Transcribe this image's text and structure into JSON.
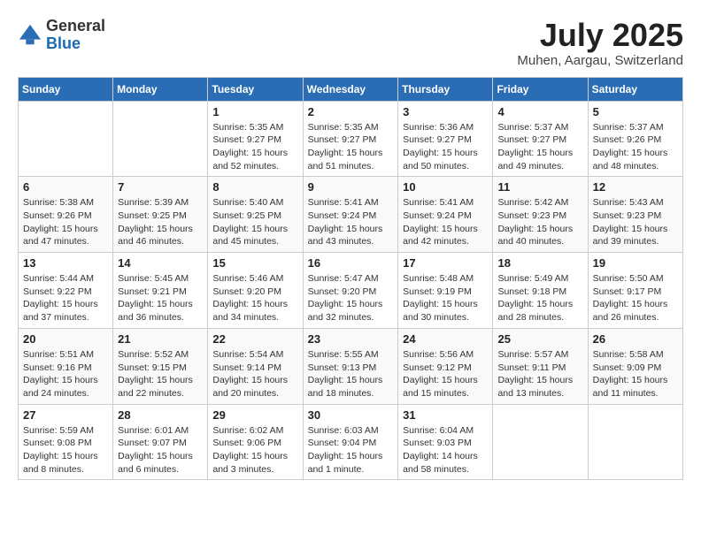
{
  "header": {
    "logo": {
      "general": "General",
      "blue": "Blue"
    },
    "title": "July 2025",
    "location": "Muhen, Aargau, Switzerland"
  },
  "weekdays": [
    "Sunday",
    "Monday",
    "Tuesday",
    "Wednesday",
    "Thursday",
    "Friday",
    "Saturday"
  ],
  "weeks": [
    [
      {
        "day": "",
        "info": ""
      },
      {
        "day": "",
        "info": ""
      },
      {
        "day": "1",
        "info": "Sunrise: 5:35 AM\nSunset: 9:27 PM\nDaylight: 15 hours\nand 52 minutes."
      },
      {
        "day": "2",
        "info": "Sunrise: 5:35 AM\nSunset: 9:27 PM\nDaylight: 15 hours\nand 51 minutes."
      },
      {
        "day": "3",
        "info": "Sunrise: 5:36 AM\nSunset: 9:27 PM\nDaylight: 15 hours\nand 50 minutes."
      },
      {
        "day": "4",
        "info": "Sunrise: 5:37 AM\nSunset: 9:27 PM\nDaylight: 15 hours\nand 49 minutes."
      },
      {
        "day": "5",
        "info": "Sunrise: 5:37 AM\nSunset: 9:26 PM\nDaylight: 15 hours\nand 48 minutes."
      }
    ],
    [
      {
        "day": "6",
        "info": "Sunrise: 5:38 AM\nSunset: 9:26 PM\nDaylight: 15 hours\nand 47 minutes."
      },
      {
        "day": "7",
        "info": "Sunrise: 5:39 AM\nSunset: 9:25 PM\nDaylight: 15 hours\nand 46 minutes."
      },
      {
        "day": "8",
        "info": "Sunrise: 5:40 AM\nSunset: 9:25 PM\nDaylight: 15 hours\nand 45 minutes."
      },
      {
        "day": "9",
        "info": "Sunrise: 5:41 AM\nSunset: 9:24 PM\nDaylight: 15 hours\nand 43 minutes."
      },
      {
        "day": "10",
        "info": "Sunrise: 5:41 AM\nSunset: 9:24 PM\nDaylight: 15 hours\nand 42 minutes."
      },
      {
        "day": "11",
        "info": "Sunrise: 5:42 AM\nSunset: 9:23 PM\nDaylight: 15 hours\nand 40 minutes."
      },
      {
        "day": "12",
        "info": "Sunrise: 5:43 AM\nSunset: 9:23 PM\nDaylight: 15 hours\nand 39 minutes."
      }
    ],
    [
      {
        "day": "13",
        "info": "Sunrise: 5:44 AM\nSunset: 9:22 PM\nDaylight: 15 hours\nand 37 minutes."
      },
      {
        "day": "14",
        "info": "Sunrise: 5:45 AM\nSunset: 9:21 PM\nDaylight: 15 hours\nand 36 minutes."
      },
      {
        "day": "15",
        "info": "Sunrise: 5:46 AM\nSunset: 9:20 PM\nDaylight: 15 hours\nand 34 minutes."
      },
      {
        "day": "16",
        "info": "Sunrise: 5:47 AM\nSunset: 9:20 PM\nDaylight: 15 hours\nand 32 minutes."
      },
      {
        "day": "17",
        "info": "Sunrise: 5:48 AM\nSunset: 9:19 PM\nDaylight: 15 hours\nand 30 minutes."
      },
      {
        "day": "18",
        "info": "Sunrise: 5:49 AM\nSunset: 9:18 PM\nDaylight: 15 hours\nand 28 minutes."
      },
      {
        "day": "19",
        "info": "Sunrise: 5:50 AM\nSunset: 9:17 PM\nDaylight: 15 hours\nand 26 minutes."
      }
    ],
    [
      {
        "day": "20",
        "info": "Sunrise: 5:51 AM\nSunset: 9:16 PM\nDaylight: 15 hours\nand 24 minutes."
      },
      {
        "day": "21",
        "info": "Sunrise: 5:52 AM\nSunset: 9:15 PM\nDaylight: 15 hours\nand 22 minutes."
      },
      {
        "day": "22",
        "info": "Sunrise: 5:54 AM\nSunset: 9:14 PM\nDaylight: 15 hours\nand 20 minutes."
      },
      {
        "day": "23",
        "info": "Sunrise: 5:55 AM\nSunset: 9:13 PM\nDaylight: 15 hours\nand 18 minutes."
      },
      {
        "day": "24",
        "info": "Sunrise: 5:56 AM\nSunset: 9:12 PM\nDaylight: 15 hours\nand 15 minutes."
      },
      {
        "day": "25",
        "info": "Sunrise: 5:57 AM\nSunset: 9:11 PM\nDaylight: 15 hours\nand 13 minutes."
      },
      {
        "day": "26",
        "info": "Sunrise: 5:58 AM\nSunset: 9:09 PM\nDaylight: 15 hours\nand 11 minutes."
      }
    ],
    [
      {
        "day": "27",
        "info": "Sunrise: 5:59 AM\nSunset: 9:08 PM\nDaylight: 15 hours\nand 8 minutes."
      },
      {
        "day": "28",
        "info": "Sunrise: 6:01 AM\nSunset: 9:07 PM\nDaylight: 15 hours\nand 6 minutes."
      },
      {
        "day": "29",
        "info": "Sunrise: 6:02 AM\nSunset: 9:06 PM\nDaylight: 15 hours\nand 3 minutes."
      },
      {
        "day": "30",
        "info": "Sunrise: 6:03 AM\nSunset: 9:04 PM\nDaylight: 15 hours\nand 1 minute."
      },
      {
        "day": "31",
        "info": "Sunrise: 6:04 AM\nSunset: 9:03 PM\nDaylight: 14 hours\nand 58 minutes."
      },
      {
        "day": "",
        "info": ""
      },
      {
        "day": "",
        "info": ""
      }
    ]
  ]
}
